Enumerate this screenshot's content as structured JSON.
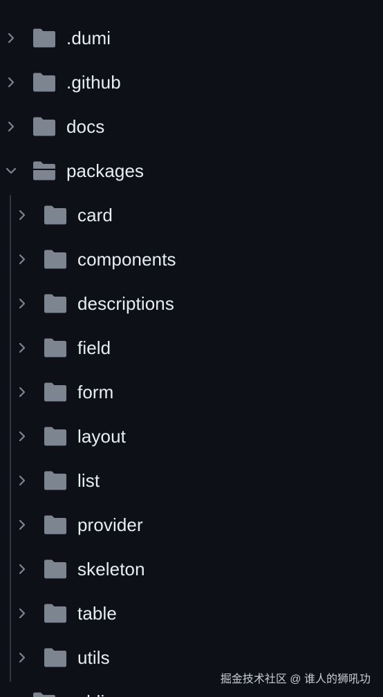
{
  "theme": {
    "background": "#0d1117",
    "text": "#e6edf3",
    "icon": "#7d8590",
    "guide": "#30363d"
  },
  "tree": {
    "top_level": [
      {
        "label": ".dumi",
        "expanded": false,
        "icon": "folder-icon",
        "chevron": "chevron-right-icon"
      },
      {
        "label": ".github",
        "expanded": false,
        "icon": "folder-icon",
        "chevron": "chevron-right-icon"
      },
      {
        "label": "docs",
        "expanded": false,
        "icon": "folder-icon",
        "chevron": "chevron-right-icon"
      },
      {
        "label": "packages",
        "expanded": true,
        "icon": "folder-open-icon",
        "chevron": "chevron-down-icon"
      }
    ],
    "packages_children": [
      {
        "label": "card"
      },
      {
        "label": "components"
      },
      {
        "label": "descriptions"
      },
      {
        "label": "field"
      },
      {
        "label": "form"
      },
      {
        "label": "layout"
      },
      {
        "label": "list"
      },
      {
        "label": "provider"
      },
      {
        "label": "skeleton"
      },
      {
        "label": "table"
      },
      {
        "label": "utils"
      }
    ],
    "next_top_level_partial": {
      "label": "public"
    }
  },
  "watermark": {
    "text": "掘金技术社区 @ 谁人的狮吼功"
  }
}
